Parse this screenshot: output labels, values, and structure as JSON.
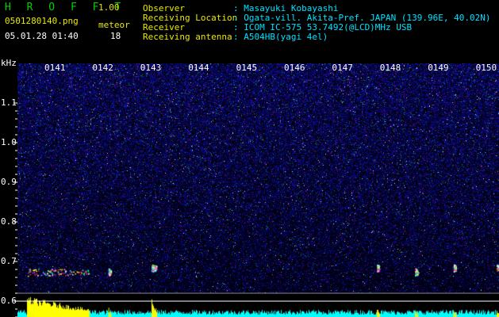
{
  "header": {
    "app_name": "H R O F F T",
    "version": "1.00",
    "filename": "0501280140.png",
    "meteor_label": "meteor",
    "meteor_count": "18",
    "datetime": "05.01.28 01:40",
    "fields": [
      {
        "key": "Observer",
        "value": ": Masayuki Kobayashi"
      },
      {
        "key": "Receiving Location",
        "value": ": Ogata-vill. Akita-Pref. JAPAN (139.96E, 40.02N)"
      },
      {
        "key": "Receiver",
        "value": ": ICOM IC-575 53.7492(@LCD)MHz USB"
      },
      {
        "key": "Receiving antenna",
        "value": ": A504HB(yagi 4el)"
      }
    ]
  },
  "axis": {
    "unit": "kHz",
    "y_ticks": [
      "1.1",
      "1.0",
      "0.9",
      "0.8",
      "0.7",
      "0.6"
    ],
    "time_ticks": [
      "0141",
      "0142",
      "0143",
      "0144",
      "0145",
      "0146",
      "0147",
      "0148",
      "0149",
      "0150"
    ]
  },
  "colors": {
    "background": "#000000",
    "noise": "#1a1a8c",
    "logo": "#00d000",
    "meta_yellow": "#e8e800",
    "meta_cyan": "#00e0ff",
    "lower_trace_yellow": "#ffff00",
    "lower_trace_cyan": "#00ffff"
  },
  "chart_data": {
    "type": "heatmap",
    "x_unit": "minute (UT)",
    "x_labels": [
      "0141",
      "0142",
      "0143",
      "0144",
      "0145",
      "0146",
      "0147",
      "0148",
      "0149",
      "0150"
    ],
    "y_unit": "kHz",
    "ylim": [
      0.58,
      1.2
    ],
    "meteor_echoes": [
      {
        "time_min": 0.0,
        "freq_khz": 0.69,
        "strength": 1.0,
        "duration_min": 1.3
      },
      {
        "time_min": 1.7,
        "freq_khz": 0.69,
        "strength": 0.5,
        "duration_min": 0.05
      },
      {
        "time_min": 2.6,
        "freq_khz": 0.7,
        "strength": 0.9,
        "duration_min": 0.1
      },
      {
        "time_min": 7.3,
        "freq_khz": 0.7,
        "strength": 0.5,
        "duration_min": 0.05
      },
      {
        "time_min": 8.1,
        "freq_khz": 0.69,
        "strength": 0.4,
        "duration_min": 0.05
      },
      {
        "time_min": 8.9,
        "freq_khz": 0.7,
        "strength": 0.4,
        "duration_min": 0.05
      },
      {
        "time_min": 9.8,
        "freq_khz": 0.7,
        "strength": 0.3,
        "duration_min": 0.05
      }
    ]
  }
}
